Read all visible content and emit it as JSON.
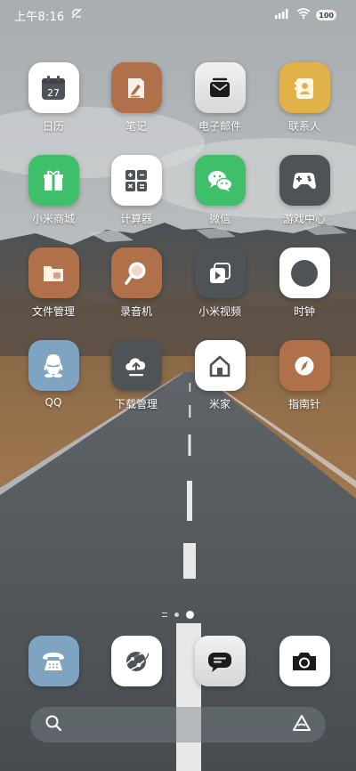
{
  "status_bar": {
    "time": "上午8:16",
    "battery": "100"
  },
  "apps": [
    {
      "label": "日历",
      "icon": "calendar-icon",
      "bg": "#ffffff",
      "day": "27"
    },
    {
      "label": "笔记",
      "icon": "notes-icon",
      "bg": "#b0714a"
    },
    {
      "label": "电子邮件",
      "icon": "email-icon",
      "bg": "#e6e6e6"
    },
    {
      "label": "联系人",
      "icon": "contacts-icon",
      "bg": "#e2b24a"
    },
    {
      "label": "小米商城",
      "icon": "gift-icon",
      "bg": "#3fbf6a"
    },
    {
      "label": "计算器",
      "icon": "calculator-icon",
      "bg": "#ffffff"
    },
    {
      "label": "微信",
      "icon": "wechat-icon",
      "bg": "#3fbf6a"
    },
    {
      "label": "游戏中心",
      "icon": "gamepad-icon",
      "bg": "#4e5358"
    },
    {
      "label": "文件管理",
      "icon": "folder-icon",
      "bg": "#b0714a"
    },
    {
      "label": "录音机",
      "icon": "recorder-icon",
      "bg": "#b0714a"
    },
    {
      "label": "小米视频",
      "icon": "video-icon",
      "bg": "#4e5358"
    },
    {
      "label": "时钟",
      "icon": "clock-icon",
      "bg": "#ffffff"
    },
    {
      "label": "QQ",
      "icon": "qq-icon",
      "bg": "#7fa4c2"
    },
    {
      "label": "下载管理",
      "icon": "download-icon",
      "bg": "#4e5358"
    },
    {
      "label": "米家",
      "icon": "home-icon",
      "bg": "#ffffff"
    },
    {
      "label": "指南针",
      "icon": "compass-icon",
      "bg": "#b0714a"
    }
  ],
  "dock": [
    {
      "name": "phone",
      "icon": "phone-icon",
      "bg": "#7fa4c2"
    },
    {
      "name": "browser",
      "icon": "browser-icon",
      "bg": "#ffffff"
    },
    {
      "name": "messages",
      "icon": "message-icon",
      "bg": "#e6e6e6"
    },
    {
      "name": "camera",
      "icon": "camera-icon",
      "bg": "#ffffff"
    }
  ],
  "page_indicator": {
    "pages": 2,
    "active": 2
  },
  "search_bar": {
    "search_icon": "search-icon",
    "assistant_icon": "assistant-icon"
  }
}
